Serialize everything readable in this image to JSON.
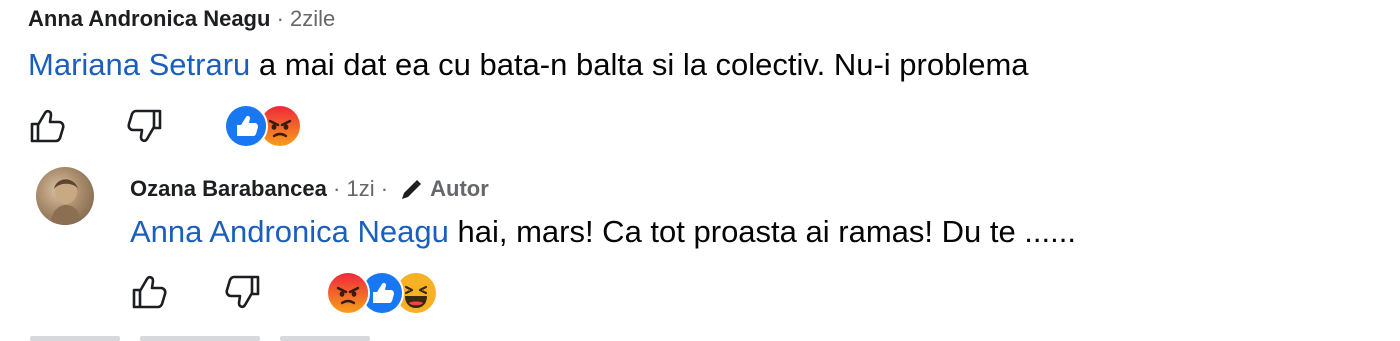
{
  "comment1": {
    "author": "Anna Andronica Neagu",
    "separator": "·",
    "time": "2zile",
    "mention": "Mariana Setraru",
    "text": " a mai dat ea cu bata-n balta si la colectiv. Nu-i problema",
    "reactions": [
      "like-icon",
      "angry-icon"
    ]
  },
  "reply1": {
    "author": "Ozana Barabancea",
    "separator": "·",
    "time": "1zi",
    "separator2": "·",
    "badge": "Autor",
    "mention": "Anna Andronica Neagu",
    "text": " hai, mars! Ca tot proasta ai ramas! Du te ......",
    "reactions": [
      "angry-icon",
      "like-icon",
      "haha-icon"
    ]
  },
  "colors": {
    "mention": "#1a5fbd",
    "like": "#1877f2",
    "angry": "#e9710f",
    "haha": "#f7b125"
  }
}
